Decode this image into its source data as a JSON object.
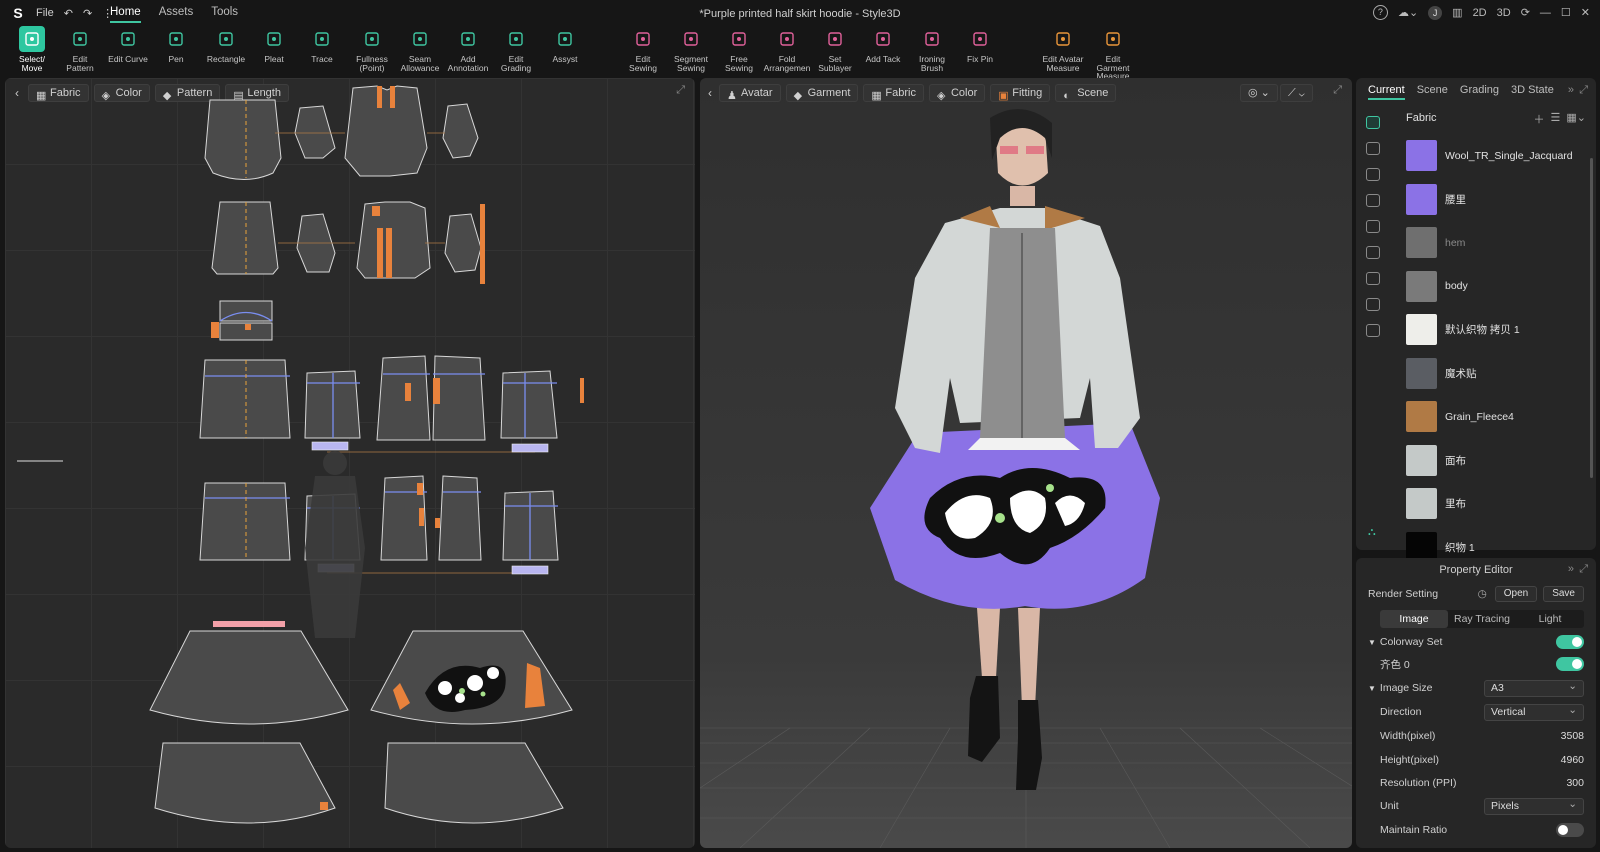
{
  "titlebar": {
    "menu_file": "File",
    "tabs": [
      "Home",
      "Assets",
      "Tools"
    ],
    "window_title": "*Purple printed half skirt hoodie - Style3D",
    "user_initial": "J",
    "view_2d": "2D",
    "view_3d": "3D"
  },
  "toolbar": [
    {
      "label": "Select/\nMove",
      "icon": "select-move-icon"
    },
    {
      "label": "Edit\nPattern",
      "icon": "edit-pattern-icon"
    },
    {
      "label": "Edit Curve",
      "icon": "edit-curve-icon"
    },
    {
      "label": "Pen",
      "icon": "pen-icon"
    },
    {
      "label": "Rectangle",
      "icon": "rectangle-icon"
    },
    {
      "label": "Pleat",
      "icon": "pleat-icon"
    },
    {
      "label": "Trace",
      "icon": "trace-icon"
    },
    {
      "label": "Fullness\n(Point)",
      "icon": "fullness-icon"
    },
    {
      "label": "Seam\nAllowance",
      "icon": "seam-allowance-icon"
    },
    {
      "label": "Add\nAnnotation",
      "icon": "annotation-icon"
    },
    {
      "label": "Edit\nGrading",
      "icon": "grading-icon"
    },
    {
      "label": "Assyst",
      "icon": "assyst-icon"
    },
    {
      "label": "Edit\nSewing",
      "icon": "edit-sewing-icon"
    },
    {
      "label": "Segment\nSewing",
      "icon": "segment-sewing-icon"
    },
    {
      "label": "Free\nSewing",
      "icon": "free-sewing-icon"
    },
    {
      "label": "Fold\nArrangemen",
      "icon": "fold-arrangement-icon"
    },
    {
      "label": "Set\nSublayer",
      "icon": "sublayer-icon"
    },
    {
      "label": "Add Tack",
      "icon": "tack-icon"
    },
    {
      "label": "Ironing\nBrush",
      "icon": "ironing-brush-icon"
    },
    {
      "label": "Fix Pin",
      "icon": "fix-pin-icon"
    },
    {
      "label": "Edit Avatar\nMeasure",
      "icon": "avatar-measure-icon"
    },
    {
      "label": "Edit Garment\nMeasure",
      "icon": "garment-measure-icon"
    }
  ],
  "panel2d": {
    "pills": [
      "Fabric",
      "Color",
      "Pattern",
      "Length"
    ]
  },
  "panel3d": {
    "pills": [
      "Avatar",
      "Garment",
      "Fabric",
      "Color",
      "Fitting",
      "Scene"
    ]
  },
  "right": {
    "tabs": [
      "Current",
      "Scene",
      "Grading",
      "3D State"
    ],
    "section": "Fabric",
    "fabrics": [
      {
        "name": "Wool_TR_Single_Jacquard",
        "color": "#8b72e6",
        "dim": false
      },
      {
        "name": "腰里",
        "color": "#8b72e6",
        "dim": false
      },
      {
        "name": "hem",
        "color": "#6f6f6f",
        "dim": true
      },
      {
        "name": "body",
        "color": "#7a7a7a",
        "dim": false
      },
      {
        "name": "默认织物 拷贝 1",
        "color": "#eeeeea",
        "dim": false
      },
      {
        "name": "魔术贴",
        "color": "#5a5d63",
        "dim": false
      },
      {
        "name": "Grain_Fleece4",
        "color": "#b07a45",
        "dim": false
      },
      {
        "name": "面布",
        "color": "#c4c9c8",
        "dim": false
      },
      {
        "name": "里布",
        "color": "#c4c9c8",
        "dim": false
      },
      {
        "name": "织物 1",
        "color": "#050505",
        "dim": false
      }
    ]
  },
  "property": {
    "title": "Property Editor",
    "render_setting": "Render Setting",
    "open": "Open",
    "save": "Save",
    "segments": [
      "Image",
      "Ray Tracing",
      "Light"
    ],
    "colorway_set": "Colorway Set",
    "colorway_item": "齐色 0",
    "image_size": "Image Size",
    "image_size_value": "A3",
    "direction": "Direction",
    "direction_value": "Vertical",
    "width_label": "Width(pixel)",
    "width_value": "3508",
    "height_label": "Height(pixel)",
    "height_value": "4960",
    "res_label": "Resolution (PPI)",
    "res_value": "300",
    "unit_label": "Unit",
    "unit_value": "Pixels",
    "ratio_label": "Maintain Ratio"
  },
  "colors": {
    "accent": "#3fc6a1",
    "purple": "#8b72e6",
    "orange": "#e8823c"
  }
}
